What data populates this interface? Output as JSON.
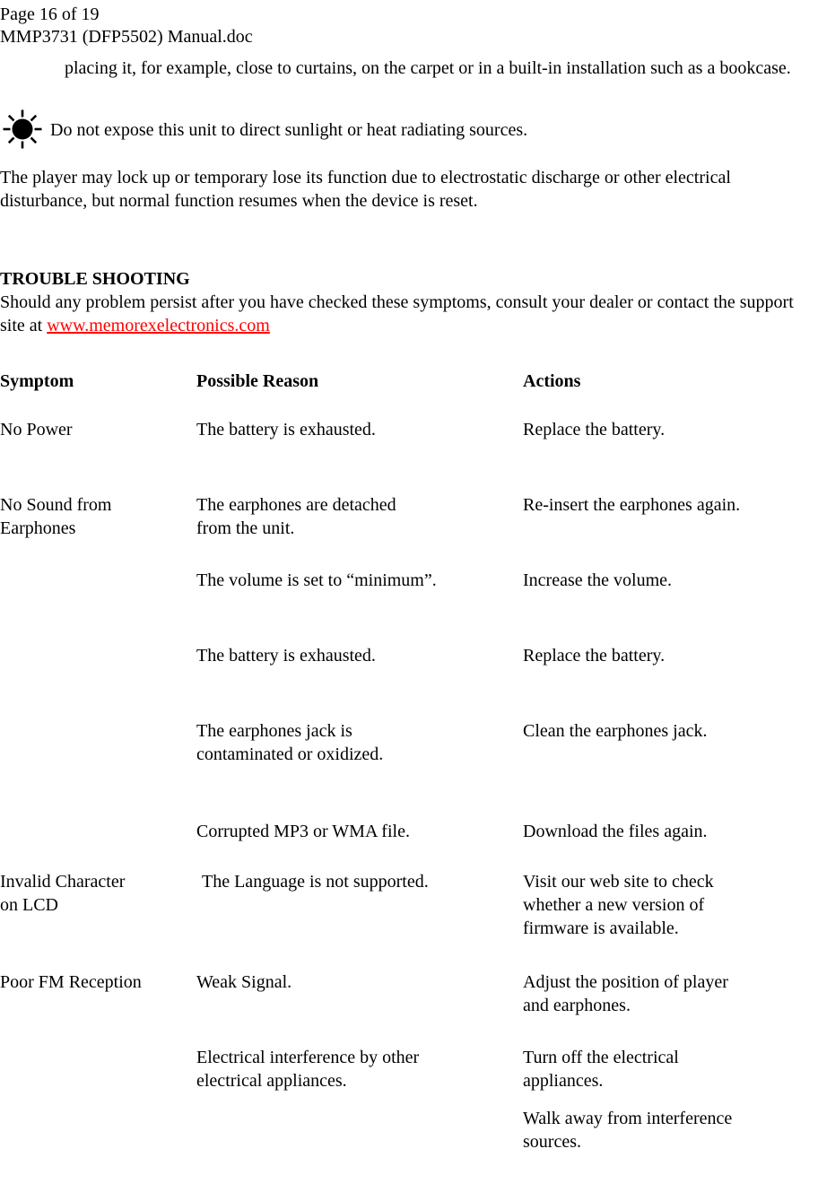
{
  "header": {
    "page_label": "Page 16 of 19",
    "document_name": "MMP3731 (DFP5502) Manual.doc"
  },
  "intro": {
    "continued_paragraph": "placing it, for example, close to curtains, on the carpet or in a built-in installation such as a bookcase."
  },
  "sunlight_notice": {
    "icon": "sun-icon",
    "text": "Do not expose this unit to direct sunlight or heat radiating sources."
  },
  "electrostatic_paragraph": "The player may lock up or temporary lose its function due to electrostatic discharge or other electrical disturbance, but normal function resumes when the device is reset.",
  "troubleshooting": {
    "title": "TROUBLE SHOOTING",
    "intro_before_link": "Should any problem persist after you have checked these symptoms, consult your dealer or contact the support site at ",
    "link_text": "www.memorexelectronics.com",
    "link_color": "#ff0000",
    "columns": [
      "Symptom",
      "Possible Reason",
      "Actions"
    ],
    "rows": [
      {
        "symptom": "No Power",
        "reason": "The battery is exhausted.",
        "action": "Replace the battery."
      },
      {
        "symptom": "No Sound from\nEarphones",
        "reason": "The earphones are detached\nfrom the unit.",
        "action": "Re-insert the earphones again."
      },
      {
        "symptom": "",
        "reason": "The volume is set to “minimum”.",
        "action": "Increase the volume."
      },
      {
        "symptom": "",
        "reason": "The battery is exhausted.",
        "action": "Replace the battery."
      },
      {
        "symptom": "",
        "reason": "The earphones jack is\ncontaminated or oxidized.",
        "action": "Clean the earphones jack."
      },
      {
        "symptom": "",
        "reason": "Corrupted MP3 or WMA file.",
        "action": "Download the files again."
      },
      {
        "symptom": "Invalid Character\non LCD",
        "reason": "The Language is not supported.",
        "action": "Visit our web site to check\nwhether a new version of\nfirmware is available."
      },
      {
        "symptom": "Poor FM Reception",
        "reason": "Weak Signal.",
        "action": "Adjust the position of player\nand earphones."
      },
      {
        "symptom": "",
        "reason": "Electrical interference by other\nelectrical appliances.",
        "action": "Turn off the electrical\nappliances."
      },
      {
        "symptom": "",
        "reason": "",
        "action": "Walk away from interference\nsources."
      }
    ]
  }
}
